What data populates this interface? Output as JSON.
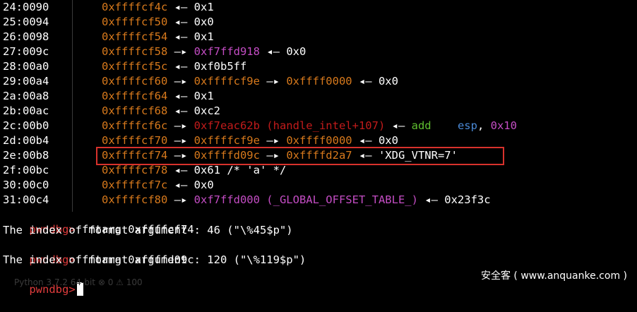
{
  "stack_rows": [
    {
      "offset": "24:0090",
      "addr": "0xffffcf4c",
      "chain": [
        {
          "t": " ◂— ",
          "c": "white"
        },
        {
          "t": "0x1",
          "c": "white"
        }
      ]
    },
    {
      "offset": "25:0094",
      "addr": "0xffffcf50",
      "chain": [
        {
          "t": " ◂— ",
          "c": "white"
        },
        {
          "t": "0x0",
          "c": "white"
        }
      ]
    },
    {
      "offset": "26:0098",
      "addr": "0xffffcf54",
      "chain": [
        {
          "t": " ◂— ",
          "c": "white"
        },
        {
          "t": "0x1",
          "c": "white"
        }
      ]
    },
    {
      "offset": "27:009c",
      "addr": "0xffffcf58",
      "chain": [
        {
          "t": " —▸ ",
          "c": "white"
        },
        {
          "t": "0xf7ffd918",
          "c": "magenta"
        },
        {
          "t": " ◂— ",
          "c": "white"
        },
        {
          "t": "0x0",
          "c": "white"
        }
      ]
    },
    {
      "offset": "28:00a0",
      "addr": "0xffffcf5c",
      "chain": [
        {
          "t": " ◂— ",
          "c": "white"
        },
        {
          "t": "0xf0b5ff",
          "c": "white"
        }
      ]
    },
    {
      "offset": "29:00a4",
      "addr": "0xffffcf60",
      "chain": [
        {
          "t": " —▸ ",
          "c": "white"
        },
        {
          "t": "0xffffcf9e",
          "c": "orange"
        },
        {
          "t": " —▸ ",
          "c": "white"
        },
        {
          "t": "0xffff0000",
          "c": "orange"
        },
        {
          "t": " ◂— ",
          "c": "white"
        },
        {
          "t": "0x0",
          "c": "white"
        }
      ]
    },
    {
      "offset": "2a:00a8",
      "addr": "0xffffcf64",
      "chain": [
        {
          "t": " ◂— ",
          "c": "white"
        },
        {
          "t": "0x1",
          "c": "white"
        }
      ]
    },
    {
      "offset": "2b:00ac",
      "addr": "0xffffcf68",
      "chain": [
        {
          "t": " ◂— ",
          "c": "white"
        },
        {
          "t": "0xc2",
          "c": "white"
        }
      ]
    },
    {
      "offset": "2c:00b0",
      "addr": "0xffffcf6c",
      "chain": [
        {
          "t": " —▸ ",
          "c": "white"
        },
        {
          "t": "0xf7eac62b (handle_intel+107)",
          "c": "red"
        },
        {
          "t": " ◂— ",
          "c": "white"
        },
        {
          "t": "add    ",
          "c": "green"
        },
        {
          "t": "esp",
          "c": "blue"
        },
        {
          "t": ", ",
          "c": "white"
        },
        {
          "t": "0x10",
          "c": "magenta"
        }
      ]
    },
    {
      "offset": "2d:00b4",
      "addr": "0xffffcf70",
      "chain": [
        {
          "t": " —▸ ",
          "c": "white"
        },
        {
          "t": "0xffffcf9e",
          "c": "orange"
        },
        {
          "t": " —▸ ",
          "c": "white"
        },
        {
          "t": "0xffff0000",
          "c": "orange"
        },
        {
          "t": " ◂— ",
          "c": "white"
        },
        {
          "t": "0x0",
          "c": "white"
        }
      ]
    },
    {
      "offset": "2e:00b8",
      "addr": "0xffffcf74",
      "chain": [
        {
          "t": " —▸ ",
          "c": "white"
        },
        {
          "t": "0xffffd09c",
          "c": "orange"
        },
        {
          "t": " —▸ ",
          "c": "white"
        },
        {
          "t": "0xffffd2a7",
          "c": "orange"
        },
        {
          "t": " ◂— ",
          "c": "white"
        },
        {
          "t": "'XDG_VTNR=7'",
          "c": "white"
        }
      ]
    },
    {
      "offset": "2f:00bc",
      "addr": "0xffffcf78",
      "chain": [
        {
          "t": " ◂— ",
          "c": "white"
        },
        {
          "t": "0x61 /* 'a' */",
          "c": "white"
        }
      ]
    },
    {
      "offset": "30:00c0",
      "addr": "0xffffcf7c",
      "chain": [
        {
          "t": " ◂— ",
          "c": "white"
        },
        {
          "t": "0x0",
          "c": "white"
        }
      ]
    },
    {
      "offset": "31:00c4",
      "addr": "0xffffcf80",
      "chain": [
        {
          "t": " —▸ ",
          "c": "white"
        },
        {
          "t": "0xf7ffd000 (_GLOBAL_OFFSET_TABLE_)",
          "c": "magenta"
        },
        {
          "t": " ◂— ",
          "c": "white"
        },
        {
          "t": "0x23f3c",
          "c": "white"
        }
      ]
    }
  ],
  "prompt": "pwndbg>",
  "commands": [
    {
      "cmd": " fmtarg 0xffffcf74",
      "output": "The index of format argument : 46 (\"\\%45$p\")"
    },
    {
      "cmd": " fmtarg 0xffffd09c",
      "output": "The index of format argument : 120 (\"\\%119$p\")"
    }
  ],
  "statusbar": "Python 3.7.2 64-bit  ⊗ 0  ⚠ 100",
  "watermark": "安全客 ( www.anquanke.com )"
}
